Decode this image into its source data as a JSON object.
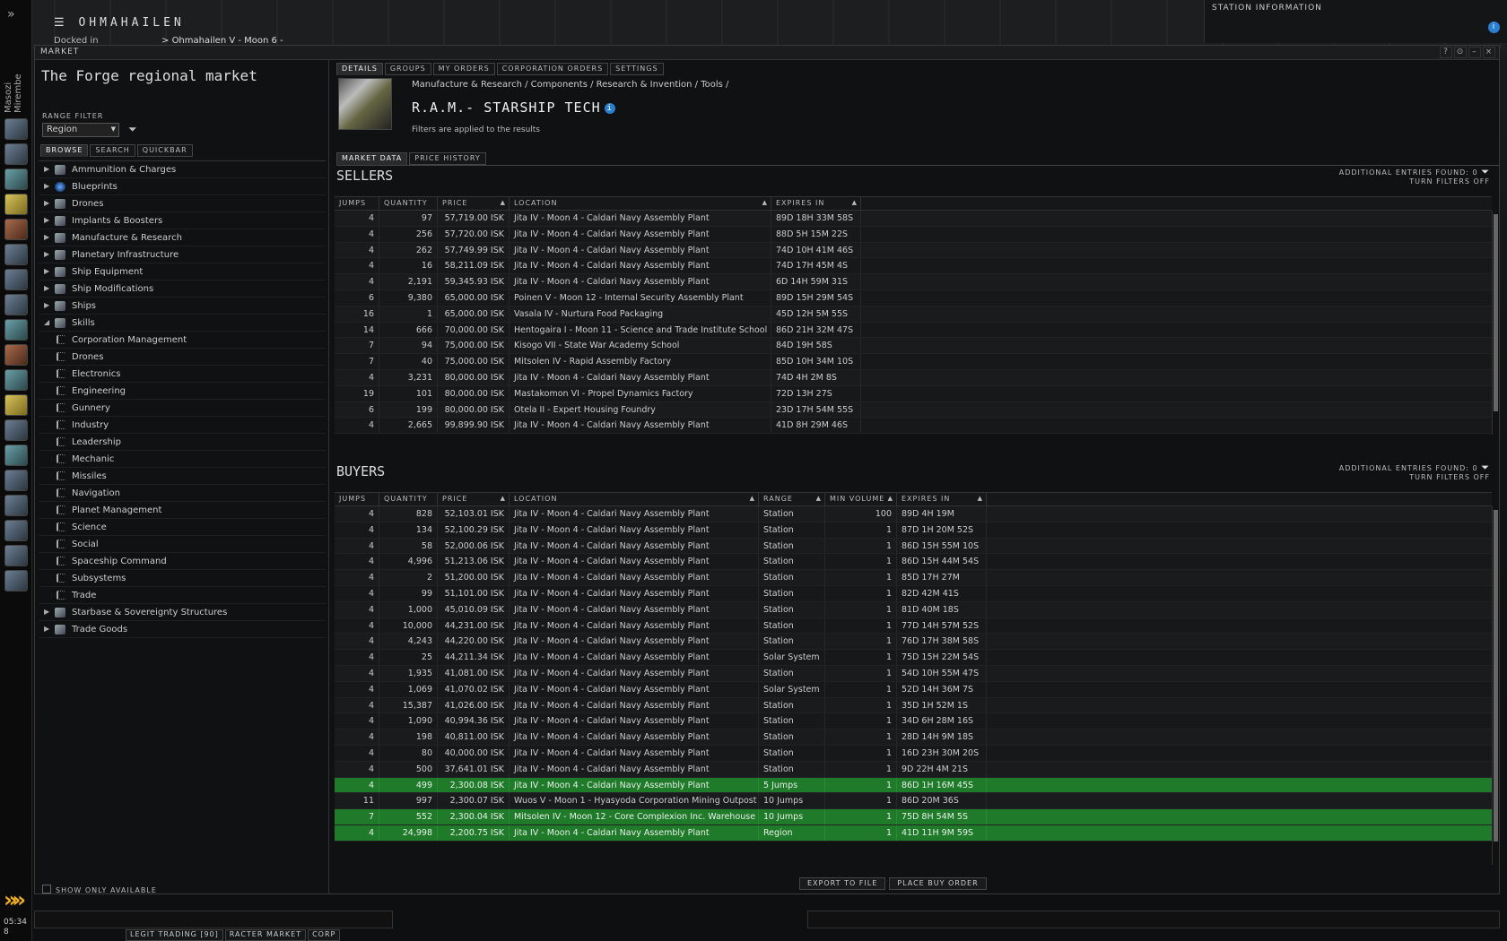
{
  "system": {
    "name": "OHMAHAILEN",
    "docked_label": "Docked in",
    "station": "Ohmahailen V - Moon 6 -"
  },
  "pilot_name": "Masozi Mirembe",
  "station_info": "STATION INFORMATION",
  "clock": {
    "time": "05:34",
    "sub": "8"
  },
  "window": {
    "title": "MARKET",
    "controls": [
      "?",
      "⊙",
      "–",
      "×"
    ]
  },
  "left": {
    "region_title": "The Forge regional market",
    "range_filter_label": "RANGE FILTER",
    "range_value": "Region",
    "tabs": [
      "BROWSE",
      "SEARCH",
      "QUICKBAR"
    ],
    "tree": [
      {
        "label": "Ammunition & Charges",
        "type": "cat",
        "open": false
      },
      {
        "label": "Blueprints",
        "type": "cat",
        "open": false,
        "icon": "blue"
      },
      {
        "label": "Drones",
        "type": "cat",
        "open": false
      },
      {
        "label": "Implants & Boosters",
        "type": "cat",
        "open": false
      },
      {
        "label": "Manufacture & Research",
        "type": "cat",
        "open": false
      },
      {
        "label": "Planetary Infrastructure",
        "type": "cat",
        "open": false
      },
      {
        "label": "Ship Equipment",
        "type": "cat",
        "open": false
      },
      {
        "label": "Ship Modifications",
        "type": "cat",
        "open": false
      },
      {
        "label": "Ships",
        "type": "cat",
        "open": false
      },
      {
        "label": "Skills",
        "type": "cat",
        "open": true
      },
      {
        "label": "Corporation Management",
        "type": "sub"
      },
      {
        "label": "Drones",
        "type": "sub"
      },
      {
        "label": "Electronics",
        "type": "sub"
      },
      {
        "label": "Engineering",
        "type": "sub"
      },
      {
        "label": "Gunnery",
        "type": "sub"
      },
      {
        "label": "Industry",
        "type": "sub"
      },
      {
        "label": "Leadership",
        "type": "sub"
      },
      {
        "label": "Mechanic",
        "type": "sub"
      },
      {
        "label": "Missiles",
        "type": "sub"
      },
      {
        "label": "Navigation",
        "type": "sub"
      },
      {
        "label": "Planet Management",
        "type": "sub"
      },
      {
        "label": "Science",
        "type": "sub"
      },
      {
        "label": "Social",
        "type": "sub"
      },
      {
        "label": "Spaceship Command",
        "type": "sub"
      },
      {
        "label": "Subsystems",
        "type": "sub"
      },
      {
        "label": "Trade",
        "type": "sub"
      },
      {
        "label": "Starbase & Sovereignty Structures",
        "type": "cat",
        "open": false
      },
      {
        "label": "Trade Goods",
        "type": "cat",
        "open": false
      }
    ],
    "show_only_available": "SHOW ONLY AVAILABLE"
  },
  "detail": {
    "tabs": [
      "DETAILS",
      "GROUPS",
      "MY ORDERS",
      "CORPORATION ORDERS",
      "SETTINGS"
    ],
    "breadcrumb": "Manufacture & Research / Components / Research & Invention / Tools /",
    "item_name": "R.A.M.- STARSHIP TECH",
    "filters_note": "Filters are applied to the results",
    "market_tabs": [
      "MARKET DATA",
      "PRICE HISTORY"
    ]
  },
  "sellers": {
    "title": "SELLERS",
    "additional": "ADDITIONAL ENTRIES FOUND: 0",
    "turn_off": "TURN FILTERS OFF",
    "columns": [
      "JUMPS",
      "QUANTITY",
      "PRICE",
      "LOCATION",
      "EXPIRES IN"
    ],
    "rows": [
      [
        "4",
        "97",
        "57,719.00 ISK",
        "Jita IV - Moon 4 - Caldari Navy Assembly Plant",
        "89D 18H 33M 58S"
      ],
      [
        "4",
        "256",
        "57,720.00 ISK",
        "Jita IV - Moon 4 - Caldari Navy Assembly Plant",
        "88D 5H 15M 22S"
      ],
      [
        "4",
        "262",
        "57,749.99 ISK",
        "Jita IV - Moon 4 - Caldari Navy Assembly Plant",
        "74D 10H 41M 46S"
      ],
      [
        "4",
        "16",
        "58,211.09 ISK",
        "Jita IV - Moon 4 - Caldari Navy Assembly Plant",
        "74D 17H 45M 4S"
      ],
      [
        "4",
        "2,191",
        "59,345.93 ISK",
        "Jita IV - Moon 4 - Caldari Navy Assembly Plant",
        "6D 14H 59M 31S"
      ],
      [
        "6",
        "9,380",
        "65,000.00 ISK",
        "Poinen V - Moon 12 - Internal Security Assembly Plant",
        "89D 15H 29M 54S"
      ],
      [
        "16",
        "1",
        "65,000.00 ISK",
        "Vasala IV - Nurtura Food Packaging",
        "45D 12H 5M 55S"
      ],
      [
        "14",
        "666",
        "70,000.00 ISK",
        "Hentogaira I - Moon 11 - Science and Trade Institute School",
        "86D 21H 32M 47S"
      ],
      [
        "7",
        "94",
        "75,000.00 ISK",
        "Kisogo VII - State War Academy School",
        "84D 19H 58S"
      ],
      [
        "7",
        "40",
        "75,000.00 ISK",
        "Mitsolen IV - Rapid Assembly Factory",
        "85D 10H 34M 10S"
      ],
      [
        "4",
        "3,231",
        "80,000.00 ISK",
        "Jita IV - Moon 4 - Caldari Navy Assembly Plant",
        "74D 4H 2M 8S"
      ],
      [
        "19",
        "101",
        "80,000.00 ISK",
        "Mastakomon VI - Propel Dynamics Factory",
        "72D 13H 27S"
      ],
      [
        "6",
        "199",
        "80,000.00 ISK",
        "Otela II - Expert Housing Foundry",
        "23D 17H 54M 55S"
      ],
      [
        "4",
        "2,665",
        "99,899.90 ISK",
        "Jita IV - Moon 4 - Caldari Navy Assembly Plant",
        "41D 8H 29M 46S"
      ]
    ]
  },
  "buyers": {
    "title": "BUYERS",
    "additional": "ADDITIONAL ENTRIES FOUND: 0",
    "turn_off": "TURN FILTERS OFF",
    "columns": [
      "JUMPS",
      "QUANTITY",
      "PRICE",
      "LOCATION",
      "RANGE",
      "MIN VOLUME",
      "EXPIRES IN"
    ],
    "rows": [
      [
        "4",
        "828",
        "52,103.01 ISK",
        "Jita IV - Moon 4 - Caldari Navy Assembly Plant",
        "Station",
        "100",
        "89D 4H 19M",
        false
      ],
      [
        "4",
        "134",
        "52,100.29 ISK",
        "Jita IV - Moon 4 - Caldari Navy Assembly Plant",
        "Station",
        "1",
        "87D 1H 20M 52S",
        false
      ],
      [
        "4",
        "58",
        "52,000.06 ISK",
        "Jita IV - Moon 4 - Caldari Navy Assembly Plant",
        "Station",
        "1",
        "86D 15H 55M 10S",
        false
      ],
      [
        "4",
        "4,996",
        "51,213.06 ISK",
        "Jita IV - Moon 4 - Caldari Navy Assembly Plant",
        "Station",
        "1",
        "86D 15H 44M 54S",
        false
      ],
      [
        "4",
        "2",
        "51,200.00 ISK",
        "Jita IV - Moon 4 - Caldari Navy Assembly Plant",
        "Station",
        "1",
        "85D 17H 27M",
        false
      ],
      [
        "4",
        "99",
        "51,101.00 ISK",
        "Jita IV - Moon 4 - Caldari Navy Assembly Plant",
        "Station",
        "1",
        "82D 42M 41S",
        false
      ],
      [
        "4",
        "1,000",
        "45,010.09 ISK",
        "Jita IV - Moon 4 - Caldari Navy Assembly Plant",
        "Station",
        "1",
        "81D 40M 18S",
        false
      ],
      [
        "4",
        "10,000",
        "44,231.00 ISK",
        "Jita IV - Moon 4 - Caldari Navy Assembly Plant",
        "Station",
        "1",
        "77D 14H 57M 52S",
        false
      ],
      [
        "4",
        "4,243",
        "44,220.00 ISK",
        "Jita IV - Moon 4 - Caldari Navy Assembly Plant",
        "Station",
        "1",
        "76D 17H 38M 58S",
        false
      ],
      [
        "4",
        "25",
        "44,211.34 ISK",
        "Jita IV - Moon 4 - Caldari Navy Assembly Plant",
        "Solar System",
        "1",
        "75D 15H 22M 54S",
        false
      ],
      [
        "4",
        "1,935",
        "41,081.00 ISK",
        "Jita IV - Moon 4 - Caldari Navy Assembly Plant",
        "Station",
        "1",
        "54D 10H 55M 47S",
        false
      ],
      [
        "4",
        "1,069",
        "41,070.02 ISK",
        "Jita IV - Moon 4 - Caldari Navy Assembly Plant",
        "Solar System",
        "1",
        "52D 14H 36M 7S",
        false
      ],
      [
        "4",
        "15,387",
        "41,026.00 ISK",
        "Jita IV - Moon 4 - Caldari Navy Assembly Plant",
        "Station",
        "1",
        "35D 1H 52M 1S",
        false
      ],
      [
        "4",
        "1,090",
        "40,994.36 ISK",
        "Jita IV - Moon 4 - Caldari Navy Assembly Plant",
        "Station",
        "1",
        "34D 6H 28M 16S",
        false
      ],
      [
        "4",
        "198",
        "40,811.00 ISK",
        "Jita IV - Moon 4 - Caldari Navy Assembly Plant",
        "Station",
        "1",
        "28D 14H 9M 18S",
        false
      ],
      [
        "4",
        "80",
        "40,000.00 ISK",
        "Jita IV - Moon 4 - Caldari Navy Assembly Plant",
        "Station",
        "1",
        "16D 23H 30M 20S",
        false
      ],
      [
        "4",
        "500",
        "37,641.01 ISK",
        "Jita IV - Moon 4 - Caldari Navy Assembly Plant",
        "Station",
        "1",
        "9D 22H 4M 21S",
        false
      ],
      [
        "4",
        "499",
        "2,300.08 ISK",
        "Jita IV - Moon 4 - Caldari Navy Assembly Plant",
        "5 Jumps",
        "1",
        "86D 1H 16M 45S",
        true
      ],
      [
        "11",
        "997",
        "2,300.07 ISK",
        "Wuos V - Moon 1 - Hyasyoda Corporation Mining Outpost",
        "10 Jumps",
        "1",
        "86D 20M 36S",
        false
      ],
      [
        "7",
        "552",
        "2,300.04 ISK",
        "Mitsolen IV - Moon 12 - Core Complexion Inc. Warehouse",
        "10 Jumps",
        "1",
        "75D 8H 54M 5S",
        true
      ],
      [
        "4",
        "24,998",
        "2,200.75 ISK",
        "Jita IV - Moon 4 - Caldari Navy Assembly Plant",
        "Region",
        "1",
        "41D 11H 9M 59S",
        true
      ]
    ]
  },
  "buttons": {
    "export": "EXPORT TO FILE",
    "place_buy": "PLACE BUY ORDER"
  },
  "chat_tabs": [
    "LEGIT TRADING [90]",
    "RACTER MARKET",
    "CORP"
  ]
}
